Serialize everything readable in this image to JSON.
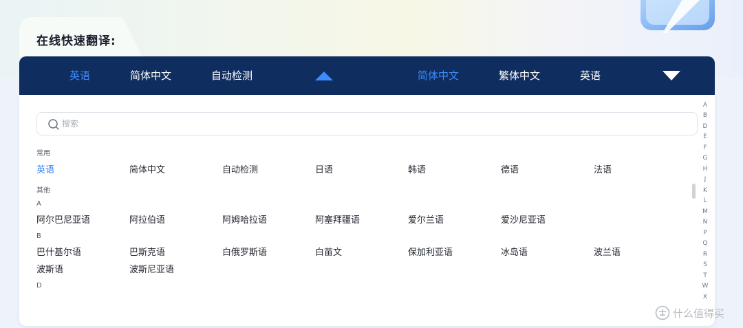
{
  "header": {
    "title": "在线快速翻译:"
  },
  "source_langs": [
    "英语",
    "简体中文",
    "自动检测"
  ],
  "target_langs": [
    "简体中文",
    "繁体中文",
    "英语"
  ],
  "colors": {
    "bar": "#0f2d5e",
    "accent": "#3d8bff",
    "panel": "#ffffff"
  },
  "search": {
    "placeholder": "搜索",
    "value": ""
  },
  "sections": {
    "common": "常用",
    "other": "其他",
    "letter_a": "A",
    "letter_b": "B",
    "letter_d": "D"
  },
  "common_items": [
    "英语",
    "简体中文",
    "自动检测",
    "日语",
    "韩语",
    "德语",
    "法语"
  ],
  "a_items": [
    "阿尔巴尼亚语",
    "阿拉伯语",
    "阿姆哈拉语",
    "阿塞拜疆语",
    "爱尔兰语",
    "爱沙尼亚语"
  ],
  "b_items_row1": [
    "巴什基尔语",
    "巴斯克语",
    "白俄罗斯语",
    "白苗文",
    "保加利亚语",
    "冰岛语",
    "波兰语"
  ],
  "b_items_row2": [
    "波斯语",
    "波斯尼亚语"
  ],
  "alphabet": [
    "A",
    "B",
    "D",
    "E",
    "F",
    "G",
    "H",
    "J",
    "K",
    "L",
    "M",
    "N",
    "P",
    "Q",
    "R",
    "S",
    "T",
    "W",
    "X"
  ],
  "watermark": {
    "icon": "zhi-logo-icon",
    "text": "什么值得买"
  }
}
